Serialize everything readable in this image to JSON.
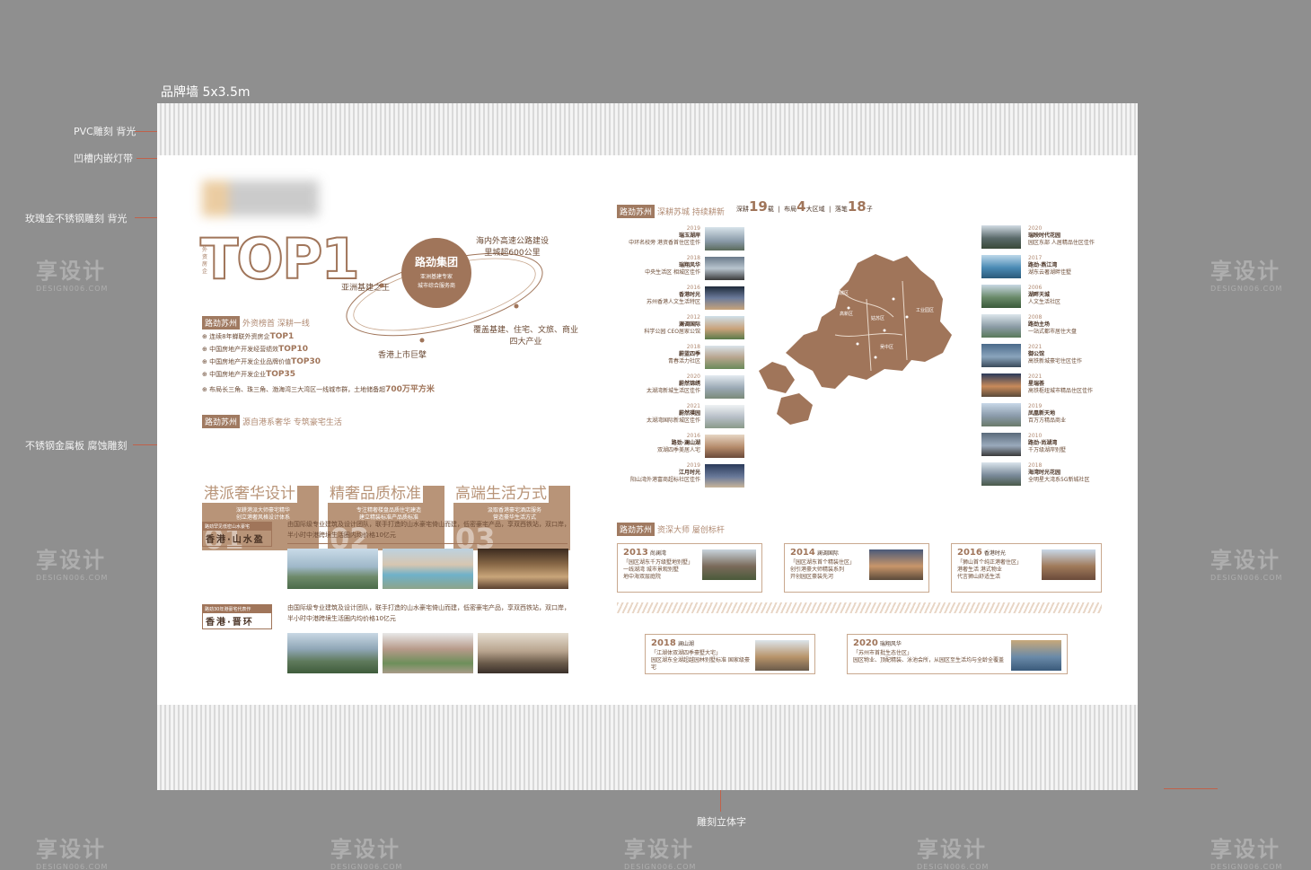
{
  "wall_title": "品牌墙 5x3.5m",
  "annotations": {
    "pvc": "PVC雕刻 背光",
    "groove": "凹槽内嵌灯带",
    "rosegold": "玫瑰金不锈钢雕刻 背光",
    "steel": "不锈钢金属板 腐蚀雕刻",
    "carved": "雕刻立体字"
  },
  "watermark": {
    "text": "享设计",
    "sub": "DESIGN006.COM"
  },
  "top1": {
    "title": "TOP1",
    "side": "外资房企"
  },
  "orbit": {
    "center_title": "路劲集团",
    "center_sub": "亚洲基建专家\n城市综合服务商",
    "left": "亚洲基建之王",
    "top_right": "海内外高速公路建设\n里城超600公里",
    "bottom": "香港上市巨擘",
    "right": "覆盖基建、住宅、文旅、商业\n四大产业"
  },
  "section1": {
    "tag": "路劲苏州",
    "sub": "外资榜首 深耕一线",
    "bullets": [
      {
        "text": "连续8年蝉联外资房企",
        "hl": "TOP1"
      },
      {
        "text": "中国房地产开发经营绩效",
        "hl": "TOP10"
      },
      {
        "text": "中国房地产开发企业品牌价值",
        "hl": "TOP30"
      },
      {
        "text": "中国房地产开发企业",
        "hl": "TOP35"
      },
      {
        "text": "布局长三角、珠三角、渤海湾三大湾区一线城市群，土地储备超",
        "hl": "700万平方米"
      }
    ]
  },
  "section2": {
    "tag": "路劲苏州",
    "sub": "源自港系奢华 专筑豪宅生活",
    "cards": [
      {
        "title": "港派奢华设计",
        "desc": "深耕港派大师豪宅精华\n创立港奢风格设计体系",
        "num": "01"
      },
      {
        "title": "精奢品质标准",
        "desc": "专注精奢楼盘品质住宅建造\n建立精装标准产品质标准",
        "num": "02"
      },
      {
        "title": "高端生活方式",
        "desc": "汲取香港豪宅酒店服务\n营造豪华生活方式",
        "num": "03"
      }
    ]
  },
  "projects": [
    {
      "tag_top": "路劲罕见低密山水豪宅",
      "name": "香港·山水盈",
      "desc": "由国际级专业建筑及设计团队，联手打造的山水豪宅倚山而建，低密豪宅产品，享双西铁站，双口岸，半小时中港跨境生活圈内均价格10亿元"
    },
    {
      "tag_top": "路劲30年港豪宅代表作",
      "name": "香港·晋环",
      "desc": "由国际级专业建筑及设计团队，联手打造的山水豪宅倚山而建，低密豪宅产品，享双西铁站，双口岸，半小时中港跨境生活圈内均价格10亿元"
    }
  ],
  "section3": {
    "tag": "路劲苏州",
    "sub": "深耕苏城 持续耕新",
    "stats": [
      {
        "label": "深耕",
        "num": "19",
        "unit": "载"
      },
      {
        "label": "布局",
        "num": "4",
        "unit": "大区域"
      },
      {
        "label": "落笔",
        "num": "18",
        "unit": "子"
      }
    ]
  },
  "map_labels": [
    "相城区",
    "工业园区",
    "姑苏区",
    "高新区",
    "吴中区"
  ],
  "timeline_left": [
    {
      "year": "2019",
      "name": "瑞玉湖岸",
      "desc": "中环名校旁 港资香首住区佳作"
    },
    {
      "year": "2018",
      "name": "瑞翔风华",
      "desc": "中央生活区 相城区佳作"
    },
    {
      "year": "2016",
      "name": "香港时光",
      "desc": "苏州香港人文生活特区"
    },
    {
      "year": "2012",
      "name": "澜调国际",
      "desc": "科学公园 CEO居家公馆"
    },
    {
      "year": "2018",
      "name": "蔚蓝四季",
      "desc": "青春活力社区"
    },
    {
      "year": "2020",
      "name": "蔚然锦绣",
      "desc": "太湖湾新城生活区佳作"
    },
    {
      "year": "2021",
      "name": "蔚然璞园",
      "desc": "太湖湾国际新城区佳作"
    },
    {
      "year": "2016",
      "name": "路劲·澜山湖",
      "desc": "双湖四季美居人宅"
    },
    {
      "year": "2019",
      "name": "江月时光",
      "desc": "阳山湾外港富商超标社区佳作"
    }
  ],
  "timeline_right": [
    {
      "year": "2020",
      "name": "瑞映时代花园",
      "desc": "园区东部 人居精品住区佳作"
    },
    {
      "year": "2017",
      "name": "路劲·燕江湾",
      "desc": "湖东云著湖畔佳墅"
    },
    {
      "year": "2006",
      "name": "湖畔天城",
      "desc": "人文生活社区"
    },
    {
      "year": "2008",
      "name": "路劲主场",
      "desc": "一站式都市居住大盘"
    },
    {
      "year": "2021",
      "name": "御公馆",
      "desc": "高铁新城豪宅住区佳作"
    },
    {
      "year": "2021",
      "name": "星瑞荟",
      "desc": "高铁枢纽城市精品住区佳作"
    },
    {
      "year": "2019",
      "name": "凤凰新天地",
      "desc": "百万方精品商业"
    },
    {
      "year": "2010",
      "name": "路劲·尚湖湾",
      "desc": "千万级湖岸别墅"
    },
    {
      "year": "2018",
      "name": "海湾时光花园",
      "desc": "全明星大湾系5G新城社区"
    }
  ],
  "section4": {
    "tag": "路劲苏州",
    "sub": "资深大师 屡创标杆",
    "awards": [
      {
        "year": "2013",
        "name": "尚澜湾",
        "desc": "「园区湖东千万级墅地别墅」\n一线湖湾 城市景观别墅\n地中海双层庭院"
      },
      {
        "year": "2014",
        "name": "澜调国际",
        "desc": "「园区湖东首个精装住区」\n创引港豪大师精装系列\n开创园区豪装先河"
      },
      {
        "year": "2016",
        "name": "香港时光",
        "desc": "「狮山首个纯正港奢住区」\n港奢生活 港式物业\n代言狮山舒适生活"
      },
      {
        "year": "2018",
        "name": "澜山湖",
        "desc": "「江湖体双湖四季豪墅大宅」\n园区湖东全湖超越园林别墅标准 国家级豪宅"
      },
      {
        "year": "2020",
        "name": "瑞翔风华",
        "desc": "「苏州市首批生态住区」\n园区物业、顶配精装、泳池会所，从园区至生活均与全龄全覆盖"
      }
    ]
  },
  "colors": {
    "accent": "#a0755a",
    "accent_light": "#b89478",
    "background": "#8f8f8f"
  }
}
